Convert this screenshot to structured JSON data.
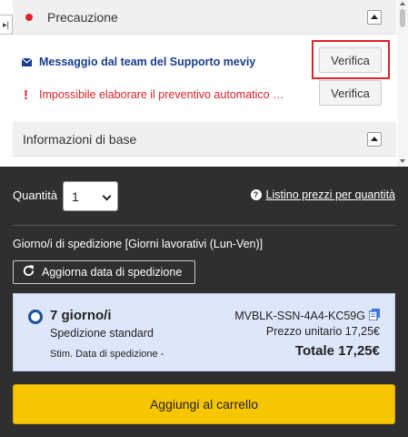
{
  "caution": {
    "title": "Precauzione",
    "messages": [
      {
        "text": "Messaggio dal team del Supporto meviy",
        "button": "Verifica"
      },
      {
        "text": "Impossibile elaborare il preventivo automatico per questo articolo",
        "button": "Verifica"
      }
    ]
  },
  "basic_info": {
    "title": "Informazioni di base"
  },
  "quantity": {
    "label": "Quantità",
    "value": "1",
    "price_list_link": "Listino prezzi per quantità"
  },
  "shipping": {
    "label": "Giorno/i di spedizione [Giorni lavorativi (Lun-Ven)]",
    "refresh_button": "Aggiorna data di spedizione",
    "option": {
      "days": "7 giorno/i",
      "type": "Spedizione standard",
      "estimated_date": "Stim. Data di spedizione -",
      "part_number": "MVBLK-SSN-4A4-KC59G",
      "unit_price": "Prezzo unitario 17,25€",
      "total": "Totale 17,25€"
    }
  },
  "cart_button": "Aggiungi al carrello",
  "colors": {
    "accent_yellow": "#f7c600",
    "alert_red": "#e0212a",
    "link_blue": "#1a3d8f",
    "dark_panel": "#2f2f2f",
    "option_bg": "#dde7f9"
  },
  "icons": [
    "sidebar-toggle-icon",
    "red-dot-icon",
    "collapse-icon",
    "mail-icon",
    "exclamation-icon",
    "question-icon",
    "refresh-icon",
    "radio-selected-icon",
    "copy-icon",
    "chevron-down-icon"
  ]
}
